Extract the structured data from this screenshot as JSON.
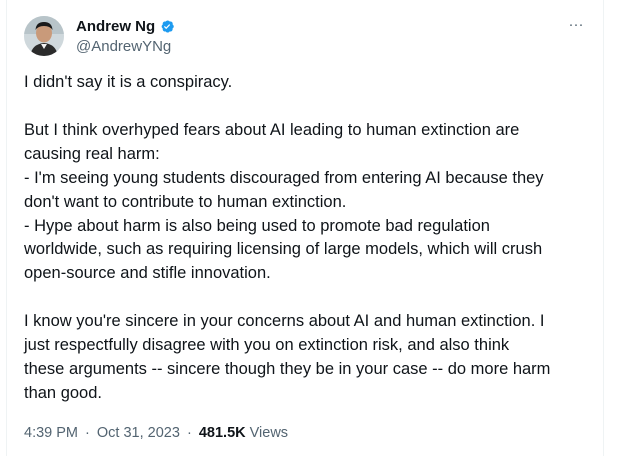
{
  "author": {
    "display_name": "Andrew Ng",
    "handle": "@AndrewYNg",
    "verified_color": "#1d9bf0"
  },
  "menu": {
    "more_label": "···"
  },
  "tweet": {
    "paragraphs": [
      "I didn't say it is a conspiracy.",
      "But I think overhyped fears about AI leading to human extinction are\ncausing real harm:\n- I'm seeing young students discouraged from entering AI because they\ndon't want to contribute to human extinction.\n- Hype about harm is also being used to promote bad regulation\nworldwide, such as requiring licensing of large models, which will crush\nopen-source and stifle innovation.",
      "I know you're sincere in your concerns about AI and human extinction. I\njust respectfully disagree with you on extinction risk, and also think\nthese arguments -- sincere though they be in your case -- do more harm\nthan good."
    ]
  },
  "meta": {
    "time": "4:39 PM",
    "date": "Oct 31, 2023",
    "separator": "·",
    "views_count": "481.5K",
    "views_label": "Views"
  }
}
